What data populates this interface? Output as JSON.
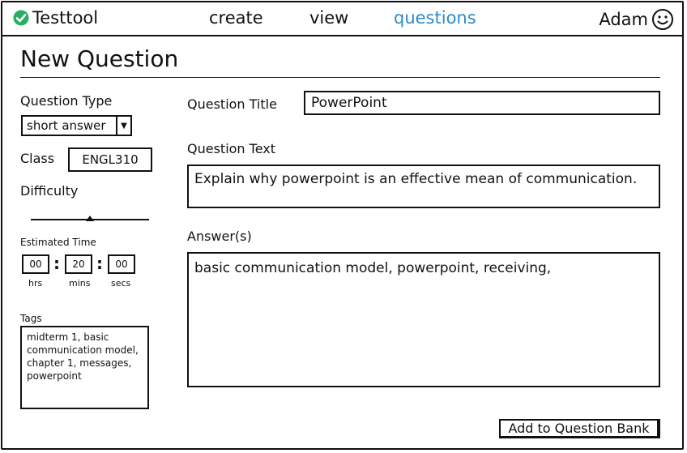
{
  "app": {
    "name": "Testtool",
    "logo_icon": "check-circle-icon",
    "accent_color": "#2c8bc6",
    "logo_color": "#27ae60"
  },
  "nav": {
    "create": "create",
    "view": "view",
    "questions": "questions",
    "active": "questions"
  },
  "user": {
    "name": "Adam",
    "avatar_icon": "smiley-icon"
  },
  "page": {
    "title": "New Question"
  },
  "form": {
    "question_type": {
      "label": "Question Type",
      "value": "short answer"
    },
    "class": {
      "label": "Class",
      "value": "ENGL310"
    },
    "difficulty": {
      "label": "Difficulty",
      "level": 0.5
    },
    "estimated_time": {
      "label": "Estimated Time",
      "hrs": "00",
      "mins": "20",
      "secs": "00",
      "hrs_label": "hrs",
      "mins_label": "mins",
      "secs_label": "secs",
      "separator": ":"
    },
    "tags": {
      "label": "Tags",
      "value": "midterm 1, basic communication model, chapter 1, messages, powerpoint"
    },
    "question_title": {
      "label": "Question Title",
      "value": "PowerPoint"
    },
    "question_text": {
      "label": "Question Text",
      "value": "Explain why powerpoint is an effective mean of communication."
    },
    "answers": {
      "label": "Answer(s)",
      "value": "basic communication model, powerpoint, receiving,"
    },
    "submit_label": "Add to Question Bank"
  }
}
